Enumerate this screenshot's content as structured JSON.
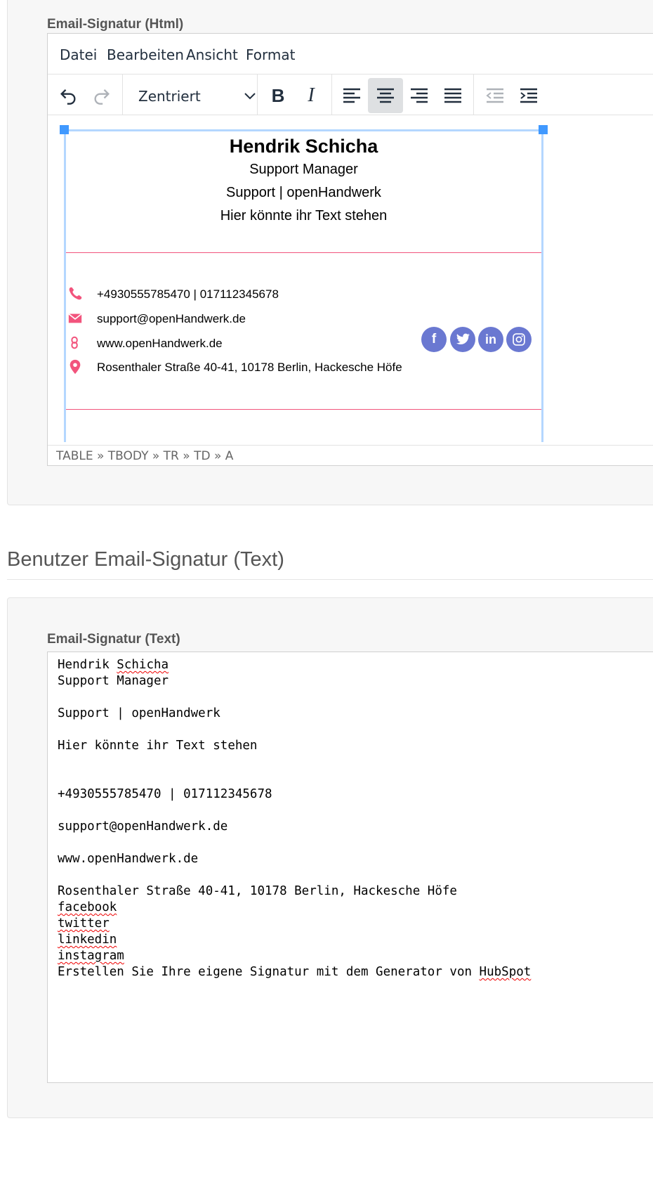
{
  "html_signature": {
    "label": "Email-Signatur (Html)",
    "menu": [
      "Datei",
      "Bearbeiten",
      "Ansicht",
      "Format"
    ],
    "toolbar": {
      "align_select_value": "Zentriert",
      "undo_icon": "undo-icon",
      "redo_icon": "redo-icon",
      "bold_icon": "bold-icon",
      "italic_icon": "italic-icon",
      "active_alignment": "center"
    },
    "signature": {
      "name": "Hendrik Schicha",
      "title": "Support Manager",
      "company": "Support | openHandwerk",
      "tagline": "Hier könnte ihr Text stehen",
      "phone": "+4930555785470 | 017112345678",
      "email": "support@openHandwerk.de",
      "website": "www.openHandwerk.de",
      "address": "Rosenthaler Straße 40-41, 10178 Berlin, Hackesche Höfe",
      "social": [
        "facebook-icon",
        "twitter-icon",
        "linkedin-icon",
        "instagram-icon"
      ],
      "accent_color": "#f2547d",
      "social_color": "#6a78d1"
    },
    "statusbar_path": "TABLE » TBODY » TR » TD » A"
  },
  "text_section": {
    "heading": "Benutzer Email-Signatur (Text)",
    "label": "Email-Signatur (Text)",
    "lines": {
      "l1a": "Hendrik ",
      "l1b": "Schicha",
      "l2": "Support Manager",
      "l3": "Support | openHandwerk",
      "l4": "Hier könnte ihr Text stehen",
      "l5": "+4930555785470 | 017112345678",
      "l6": "support@openHandwerk.de",
      "l7": "www.openHandwerk.de",
      "l8": "Rosenthaler Straße 40-41, 10178 Berlin, Hackesche Höfe",
      "l9": "facebook",
      "l10": "twitter",
      "l11": "linkedin",
      "l12": "instagram",
      "l13a": "Erstellen Sie Ihre eigene Signatur mit dem Generator von ",
      "l13b": "HubSpot"
    }
  }
}
